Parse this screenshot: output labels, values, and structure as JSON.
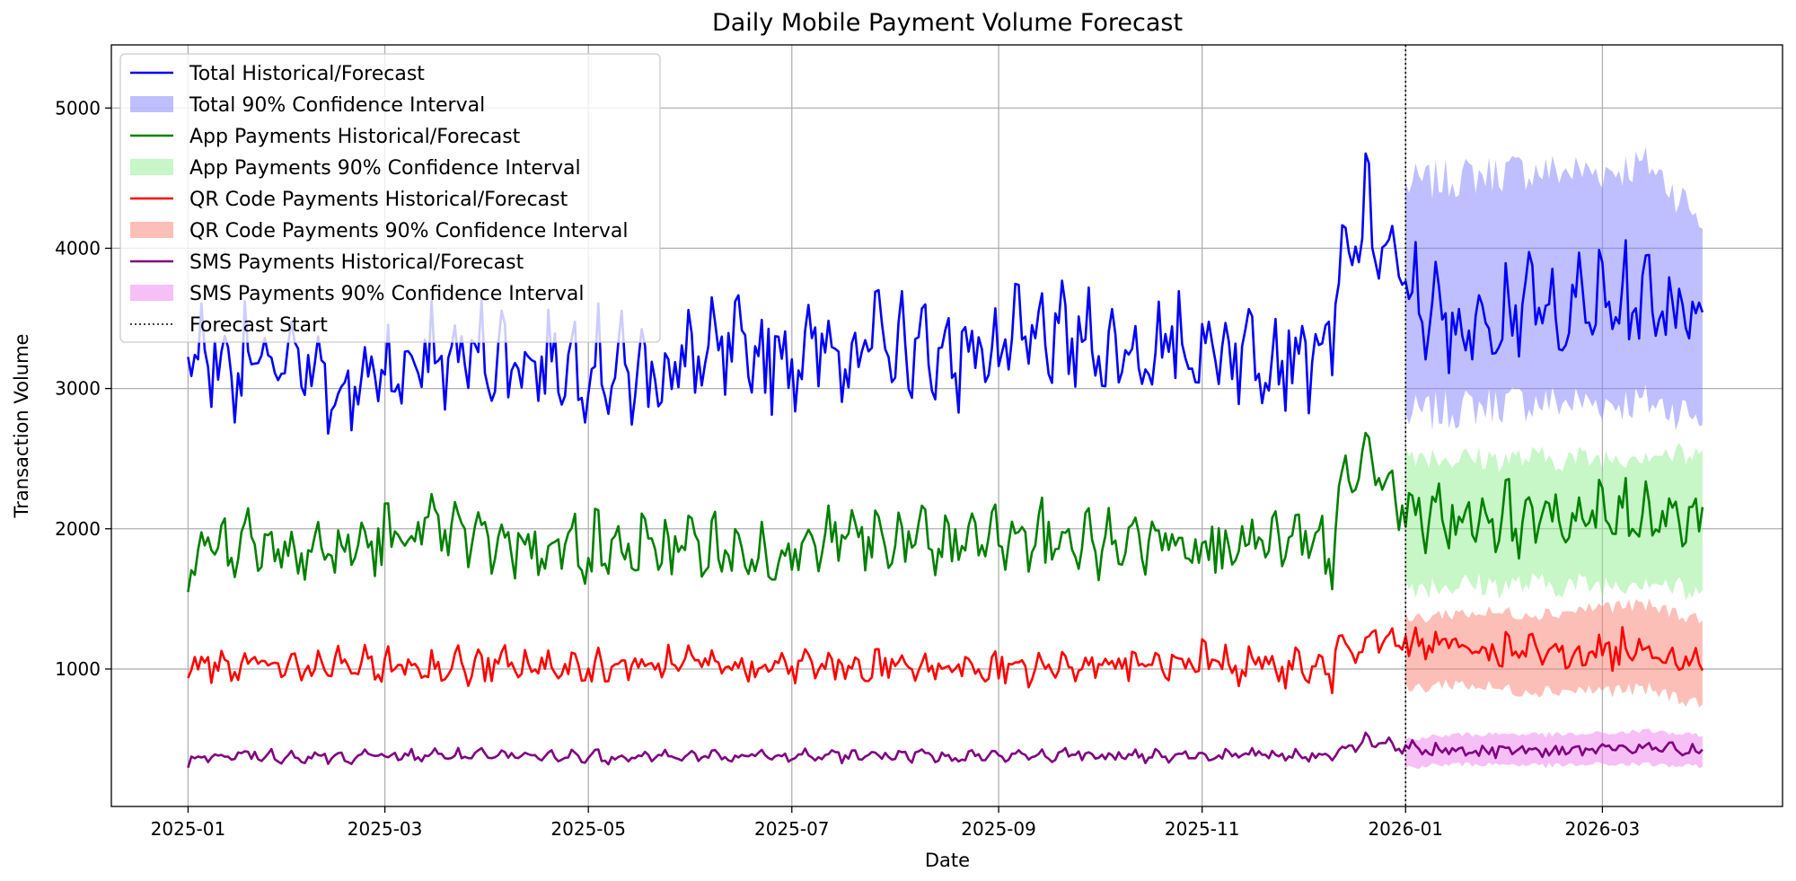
{
  "chart_data": {
    "type": "line",
    "title": "Daily Mobile Payment Volume Forecast",
    "xlabel": "Date",
    "ylabel": "Transaction Volume",
    "x_range": [
      "2024-12-09",
      "2026-04-24"
    ],
    "ylim": [
      20,
      5450
    ],
    "x_ticks": [
      "2025-01",
      "2025-03",
      "2025-05",
      "2025-07",
      "2025-09",
      "2025-11",
      "2026-01",
      "2026-03"
    ],
    "x_tick_dates": [
      "2025-01-01",
      "2025-03-01",
      "2025-05-01",
      "2025-07-01",
      "2025-09-01",
      "2025-11-01",
      "2026-01-01",
      "2026-03-01"
    ],
    "y_ticks": [
      1000,
      2000,
      3000,
      4000,
      5000
    ],
    "y_tick_labels": [
      "1000",
      "2000",
      "3000",
      "4000",
      "5000"
    ],
    "grid": true,
    "legend_position": "top-left",
    "forecast_start": "2026-01-01",
    "forecast_start_label": "Forecast Start",
    "series": [
      {
        "name": "Total Historical/Forecast",
        "band_name": "Total 90% Confidence Interval",
        "color": "#0000ff",
        "band_color": "#8080ff",
        "points": [
          [
            "2025-01-01",
            3200
          ],
          [
            "2025-01-15",
            3150
          ],
          [
            "2025-02-01",
            3100
          ],
          [
            "2025-02-15",
            2950
          ],
          [
            "2025-03-01",
            3050
          ],
          [
            "2025-03-15",
            3150
          ],
          [
            "2025-04-01",
            3200
          ],
          [
            "2025-04-15",
            3150
          ],
          [
            "2025-05-01",
            3150
          ],
          [
            "2025-05-15",
            3050
          ],
          [
            "2025-06-01",
            3150
          ],
          [
            "2025-06-15",
            3200
          ],
          [
            "2025-07-01",
            3200
          ],
          [
            "2025-07-15",
            3250
          ],
          [
            "2025-08-01",
            3250
          ],
          [
            "2025-08-15",
            3200
          ],
          [
            "2025-09-01",
            3250
          ],
          [
            "2025-09-15",
            3300
          ],
          [
            "2025-10-01",
            3250
          ],
          [
            "2025-10-15",
            3200
          ],
          [
            "2025-11-01",
            3250
          ],
          [
            "2025-11-15",
            3250
          ],
          [
            "2025-12-01",
            3200
          ],
          [
            "2025-12-10",
            3250
          ],
          [
            "2025-12-12",
            3700
          ],
          [
            "2025-12-20",
            4200
          ],
          [
            "2025-12-31",
            3700
          ],
          [
            "2026-01-15",
            3350
          ],
          [
            "2026-02-01",
            3550
          ],
          [
            "2026-02-15",
            3500
          ],
          [
            "2026-03-01",
            3550
          ],
          [
            "2026-03-15",
            3600
          ],
          [
            "2026-03-31",
            3500
          ]
        ],
        "ci_lower": [
          [
            "2026-01-01",
            2800
          ],
          [
            "2026-01-15",
            2850
          ],
          [
            "2026-02-01",
            2900
          ],
          [
            "2026-02-15",
            2900
          ],
          [
            "2026-03-01",
            2900
          ],
          [
            "2026-03-15",
            2900
          ],
          [
            "2026-03-31",
            2800
          ]
        ],
        "ci_upper": [
          [
            "2026-01-01",
            4450
          ],
          [
            "2026-01-15",
            4500
          ],
          [
            "2026-02-01",
            4550
          ],
          [
            "2026-02-15",
            4550
          ],
          [
            "2026-03-01",
            4550
          ],
          [
            "2026-03-15",
            4600
          ],
          [
            "2026-03-31",
            4200
          ]
        ]
      },
      {
        "name": "App Payments Historical/Forecast",
        "band_name": "App Payments 90% Confidence Interval",
        "color": "#008000",
        "band_color": "#90ee90",
        "points": [
          [
            "2025-01-01",
            1800
          ],
          [
            "2025-01-15",
            1900
          ],
          [
            "2025-02-01",
            1850
          ],
          [
            "2025-02-15",
            1800
          ],
          [
            "2025-03-01",
            1900
          ],
          [
            "2025-03-15",
            1950
          ],
          [
            "2025-04-01",
            1900
          ],
          [
            "2025-04-15",
            1850
          ],
          [
            "2025-05-01",
            1850
          ],
          [
            "2025-05-15",
            1800
          ],
          [
            "2025-06-01",
            1850
          ],
          [
            "2025-06-15",
            1800
          ],
          [
            "2025-07-01",
            1800
          ],
          [
            "2025-07-15",
            1900
          ],
          [
            "2025-08-01",
            1900
          ],
          [
            "2025-08-15",
            1850
          ],
          [
            "2025-09-01",
            1900
          ],
          [
            "2025-09-15",
            1900
          ],
          [
            "2025-10-01",
            1850
          ],
          [
            "2025-10-15",
            1900
          ],
          [
            "2025-11-01",
            1900
          ],
          [
            "2025-11-15",
            1850
          ],
          [
            "2025-12-01",
            1850
          ],
          [
            "2025-12-10",
            1800
          ],
          [
            "2025-12-12",
            2150
          ],
          [
            "2025-12-20",
            2500
          ],
          [
            "2025-12-31",
            2100
          ],
          [
            "2026-01-15",
            2050
          ],
          [
            "2026-02-01",
            2050
          ],
          [
            "2026-02-15",
            2050
          ],
          [
            "2026-03-01",
            2050
          ],
          [
            "2026-03-15",
            2100
          ],
          [
            "2026-03-31",
            2050
          ]
        ],
        "ci_lower": [
          [
            "2026-01-01",
            1600
          ],
          [
            "2026-01-15",
            1600
          ],
          [
            "2026-02-01",
            1600
          ],
          [
            "2026-02-15",
            1600
          ],
          [
            "2026-03-01",
            1600
          ],
          [
            "2026-03-15",
            1650
          ],
          [
            "2026-03-31",
            1500
          ]
        ],
        "ci_upper": [
          [
            "2026-01-01",
            2550
          ],
          [
            "2026-01-15",
            2500
          ],
          [
            "2026-02-01",
            2500
          ],
          [
            "2026-02-15",
            2500
          ],
          [
            "2026-03-01",
            2500
          ],
          [
            "2026-03-15",
            2550
          ],
          [
            "2026-03-31",
            2500
          ]
        ]
      },
      {
        "name": "QR Code Payments Historical/Forecast",
        "band_name": "QR Code Payments 90% Confidence Interval",
        "color": "#ff0000",
        "band_color": "#fa8072",
        "points": [
          [
            "2025-01-01",
            1000
          ],
          [
            "2025-01-15",
            1000
          ],
          [
            "2025-02-01",
            1000
          ],
          [
            "2025-02-15",
            1000
          ],
          [
            "2025-03-01",
            1000
          ],
          [
            "2025-03-15",
            1000
          ],
          [
            "2025-04-01",
            1000
          ],
          [
            "2025-04-15",
            1000
          ],
          [
            "2025-05-01",
            1000
          ],
          [
            "2025-05-15",
            1000
          ],
          [
            "2025-06-01",
            1000
          ],
          [
            "2025-06-15",
            1000
          ],
          [
            "2025-07-01",
            1000
          ],
          [
            "2025-07-15",
            1000
          ],
          [
            "2025-08-01",
            1000
          ],
          [
            "2025-08-15",
            1000
          ],
          [
            "2025-09-01",
            1000
          ],
          [
            "2025-09-15",
            1000
          ],
          [
            "2025-10-01",
            1000
          ],
          [
            "2025-10-15",
            1000
          ],
          [
            "2025-11-01",
            1050
          ],
          [
            "2025-11-15",
            1000
          ],
          [
            "2025-12-01",
            1000
          ],
          [
            "2025-12-10",
            950
          ],
          [
            "2025-12-12",
            1150
          ],
          [
            "2025-12-20",
            1200
          ],
          [
            "2025-12-31",
            1150
          ],
          [
            "2026-01-15",
            1150
          ],
          [
            "2026-02-01",
            1100
          ],
          [
            "2026-02-15",
            1100
          ],
          [
            "2026-03-01",
            1100
          ],
          [
            "2026-03-15",
            1150
          ],
          [
            "2026-03-31",
            1000
          ]
        ],
        "ci_lower": [
          [
            "2026-01-01",
            850
          ],
          [
            "2026-01-15",
            900
          ],
          [
            "2026-02-01",
            850
          ],
          [
            "2026-02-15",
            850
          ],
          [
            "2026-03-01",
            850
          ],
          [
            "2026-03-15",
            850
          ],
          [
            "2026-03-31",
            750
          ]
        ],
        "ci_upper": [
          [
            "2026-01-01",
            1350
          ],
          [
            "2026-01-15",
            1400
          ],
          [
            "2026-02-01",
            1400
          ],
          [
            "2026-02-15",
            1400
          ],
          [
            "2026-03-01",
            1450
          ],
          [
            "2026-03-15",
            1450
          ],
          [
            "2026-03-31",
            1350
          ]
        ]
      },
      {
        "name": "SMS Payments Historical/Forecast",
        "band_name": "SMS Payments 90% Confidence Interval",
        "color": "#800080",
        "band_color": "#ee82ee",
        "points": [
          [
            "2025-01-01",
            350
          ],
          [
            "2025-01-15",
            380
          ],
          [
            "2025-02-01",
            370
          ],
          [
            "2025-02-15",
            370
          ],
          [
            "2025-03-01",
            370
          ],
          [
            "2025-03-15",
            380
          ],
          [
            "2025-04-01",
            370
          ],
          [
            "2025-04-15",
            370
          ],
          [
            "2025-05-01",
            370
          ],
          [
            "2025-05-15",
            370
          ],
          [
            "2025-06-01",
            370
          ],
          [
            "2025-06-15",
            370
          ],
          [
            "2025-07-01",
            370
          ],
          [
            "2025-07-15",
            380
          ],
          [
            "2025-08-01",
            380
          ],
          [
            "2025-08-15",
            380
          ],
          [
            "2025-09-01",
            370
          ],
          [
            "2025-09-15",
            380
          ],
          [
            "2025-10-01",
            380
          ],
          [
            "2025-10-15",
            380
          ],
          [
            "2025-11-01",
            380
          ],
          [
            "2025-11-15",
            380
          ],
          [
            "2025-12-01",
            380
          ],
          [
            "2025-12-10",
            380
          ],
          [
            "2025-12-12",
            420
          ],
          [
            "2025-12-20",
            480
          ],
          [
            "2025-12-31",
            430
          ],
          [
            "2026-01-15",
            410
          ],
          [
            "2026-02-01",
            420
          ],
          [
            "2026-02-15",
            410
          ],
          [
            "2026-03-01",
            420
          ],
          [
            "2026-03-15",
            430
          ],
          [
            "2026-03-31",
            400
          ]
        ],
        "ci_lower": [
          [
            "2026-01-01",
            300
          ],
          [
            "2026-01-15",
            320
          ],
          [
            "2026-02-01",
            320
          ],
          [
            "2026-02-15",
            310
          ],
          [
            "2026-03-01",
            320
          ],
          [
            "2026-03-15",
            320
          ],
          [
            "2026-03-31",
            300
          ]
        ],
        "ci_upper": [
          [
            "2026-01-01",
            500
          ],
          [
            "2026-01-15",
            530
          ],
          [
            "2026-02-01",
            540
          ],
          [
            "2026-02-15",
            530
          ],
          [
            "2026-03-01",
            540
          ],
          [
            "2026-03-15",
            560
          ],
          [
            "2026-03-31",
            520
          ]
        ]
      }
    ]
  }
}
